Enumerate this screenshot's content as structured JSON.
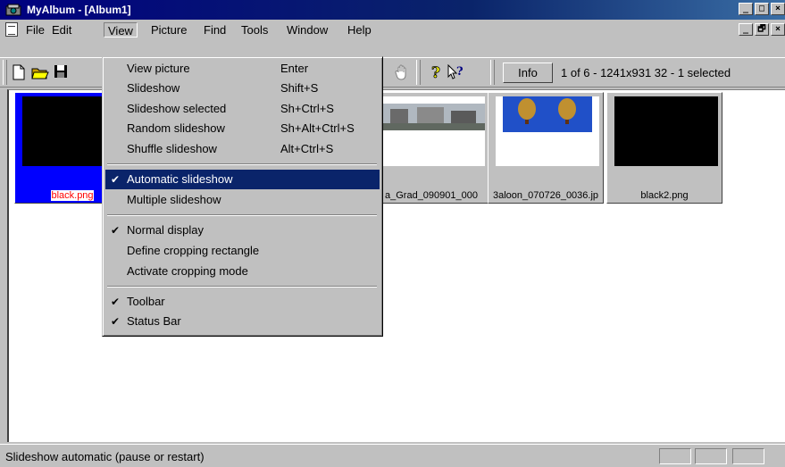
{
  "window": {
    "title": "MyAlbum - [Album1]",
    "controls": [
      "_",
      "□",
      "×"
    ]
  },
  "menubar": {
    "items": [
      "File",
      "Edit",
      "View",
      "Picture",
      "Find",
      "Tools",
      "Window",
      "Help"
    ],
    "mdi_controls": [
      "_",
      "🗗",
      "×"
    ]
  },
  "toolbar": {
    "icons": [
      "new-file-icon",
      "open-folder-icon",
      "save-disk-icon",
      "hand-icon",
      "help-icon",
      "context-help-icon"
    ],
    "info_label": "Info",
    "status": "1 of 6 - 1241x931 32 - 1 selected"
  },
  "thumbnails": [
    {
      "label": "black.png",
      "selected": true
    },
    {
      "label": "a_Grad_090901_000",
      "selected": false
    },
    {
      "label": "3aloon_070726_0036.jp",
      "selected": false
    },
    {
      "label": "black2.png",
      "selected": false
    }
  ],
  "view_menu": {
    "items": [
      {
        "label": "View picture",
        "shortcut": "Enter",
        "checked": false
      },
      {
        "label": "Slideshow",
        "shortcut": "Shift+S",
        "checked": false
      },
      {
        "label": "Slideshow selected",
        "shortcut": "Sh+Ctrl+S",
        "checked": false
      },
      {
        "label": "Random slideshow",
        "shortcut": "Sh+Alt+Ctrl+S",
        "checked": false
      },
      {
        "label": "Shuffle slideshow",
        "shortcut": "Alt+Ctrl+S",
        "checked": false
      },
      {
        "label": "Automatic slideshow",
        "shortcut": "",
        "checked": true,
        "highlighted": true
      },
      {
        "label": "Multiple slideshow",
        "shortcut": "",
        "checked": false
      },
      {
        "label": "Normal display",
        "shortcut": "",
        "checked": true
      },
      {
        "label": "Define cropping rectangle",
        "shortcut": "",
        "checked": false
      },
      {
        "label": "Activate cropping mode",
        "shortcut": "",
        "checked": false
      },
      {
        "label": "Toolbar",
        "shortcut": "",
        "checked": true
      },
      {
        "label": "Status Bar",
        "shortcut": "",
        "checked": true
      }
    ]
  },
  "statusbar": {
    "message": "Slideshow automatic (pause or restart)"
  },
  "colors": {
    "title_bar": "#000080",
    "menu_highlight": "#0a246a",
    "selection": "#0000ff",
    "selected_label": "#ff0000"
  }
}
